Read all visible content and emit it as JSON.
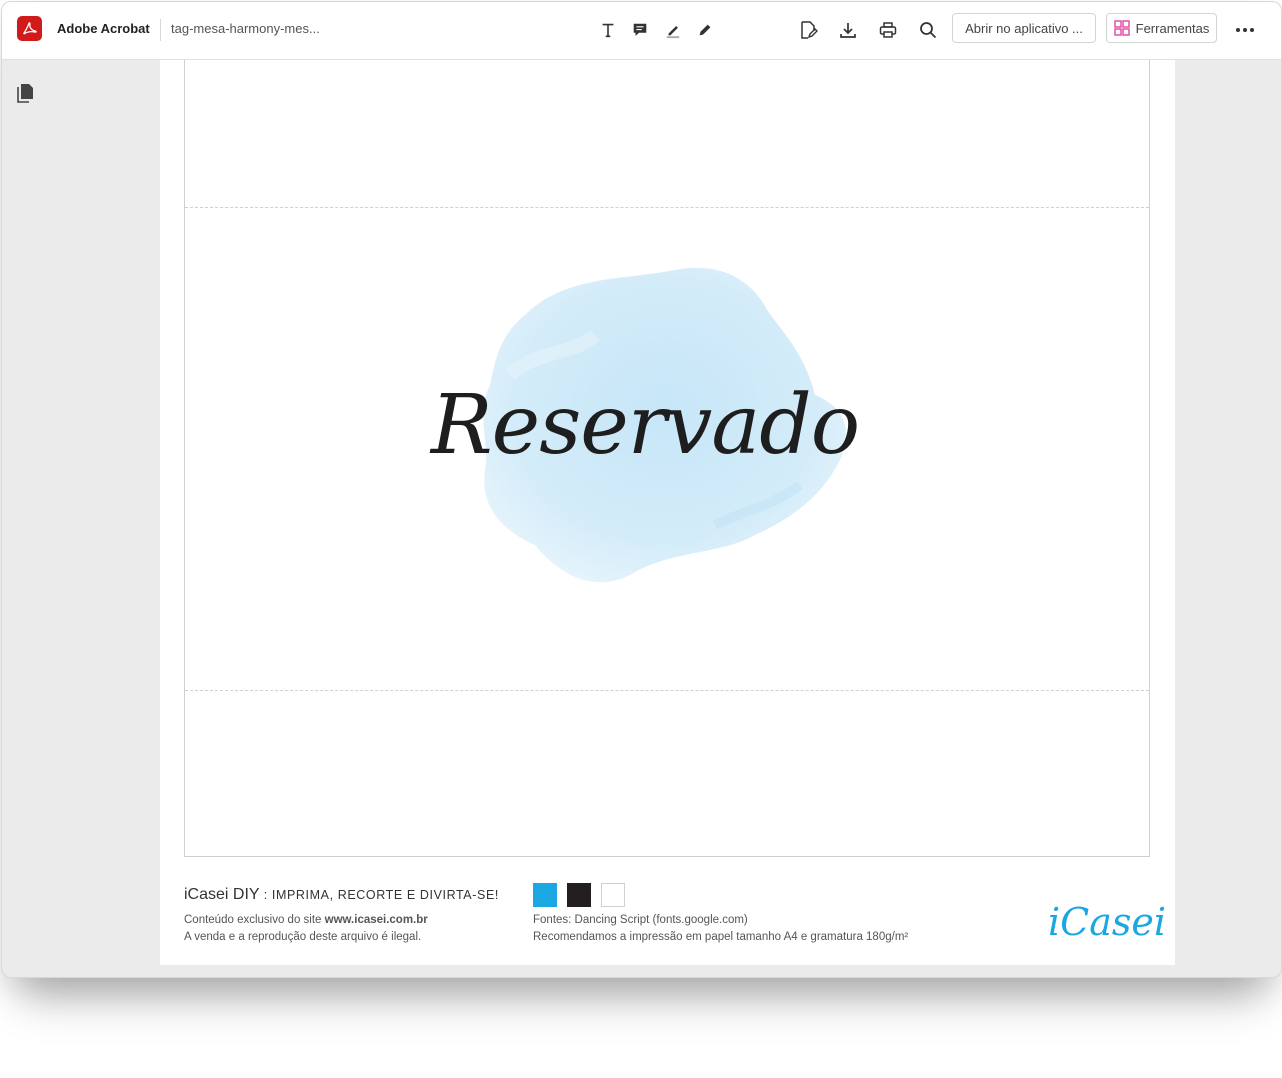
{
  "toolbar": {
    "app_name": "Adobe Acrobat",
    "document_name": "tag-mesa-harmony-mes...",
    "open_in_app_label": "Abrir no aplicativo ...",
    "tools_label": "Ferramentas"
  },
  "document": {
    "title_script": "Reservado",
    "footer": {
      "brand": "iCasei DIY",
      "tagline": ": IMPRIMA, RECORTE E DIVIRTA-SE!",
      "exclusive_prefix": "Conteúdo exclusivo do site ",
      "site": "www.icasei.com.br",
      "legal": "A venda e a reprodução deste arquivo é ilegal.",
      "fonts": "Fontes: Dancing Script (fonts.google.com)",
      "recommendation": "Recomendamos a impressão em papel tamanho A4 e gramatura 180g/m²",
      "logo": "iCasei"
    },
    "palette": [
      "#1aa7e2",
      "#231f20",
      "#ffffff"
    ]
  },
  "colors": {
    "acrobat_red": "#d11b1b",
    "tools_pink": "#e0479e",
    "splash_blue": "#cfe9f8"
  }
}
